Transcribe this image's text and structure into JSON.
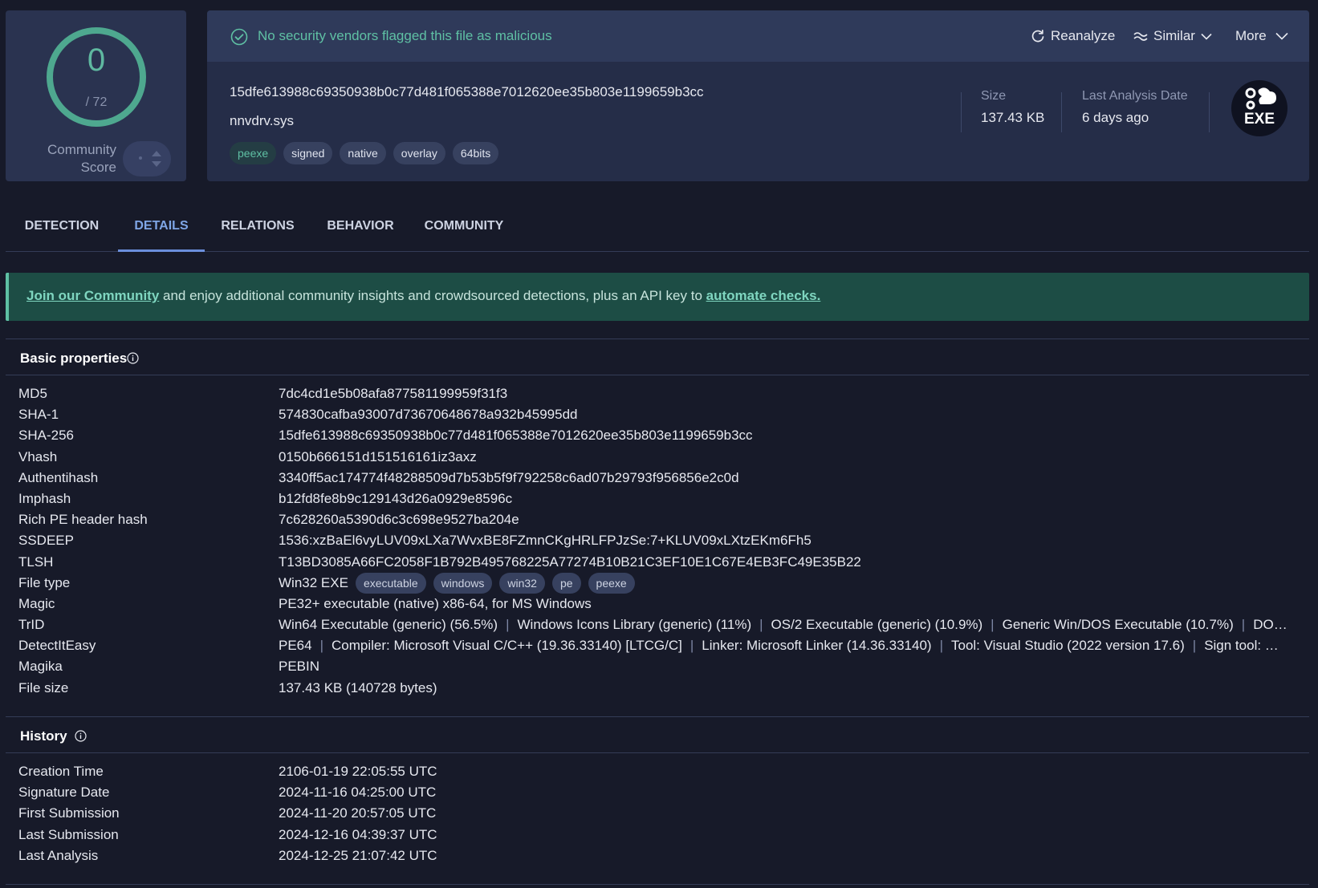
{
  "score": {
    "positives": "0",
    "total": "/ 72",
    "community_label": "Community Score",
    "ring_color": "#4ea88f"
  },
  "verdict": {
    "text": "No security vendors flagged this file as malicious",
    "color": "#5fc0a4",
    "icon": "check-circle-icon"
  },
  "actions": {
    "reanalyze": "Reanalyze",
    "similar": "Similar",
    "more": "More"
  },
  "file": {
    "sha256": "15dfe613988c69350938b0c77d481f065388e7012620ee35b803e1199659b3cc",
    "name": "nnvdrv.sys",
    "tags": [
      "peexe",
      "signed",
      "native",
      "overlay",
      "64bits"
    ],
    "size_label": "Size",
    "size_value": "137.43 KB",
    "last_analysis_label": "Last Analysis Date",
    "last_analysis_value": "6 days ago",
    "type_badge": "EXE"
  },
  "tabs": [
    "DETECTION",
    "DETAILS",
    "RELATIONS",
    "BEHAVIOR",
    "COMMUNITY"
  ],
  "active_tab": "DETAILS",
  "banner": {
    "link1": "Join our Community",
    "middle": " and enjoy additional community insights and crowdsourced detections, plus an API key to ",
    "link2": "automate checks."
  },
  "basic": {
    "title": "Basic properties",
    "rows": [
      {
        "k": "MD5",
        "v": "7dc4cd1e5b08afa877581199959f31f3"
      },
      {
        "k": "SHA-1",
        "v": "574830cafba93007d73670648678a932b45995dd"
      },
      {
        "k": "SHA-256",
        "v": "15dfe613988c69350938b0c77d481f065388e7012620ee35b803e1199659b3cc"
      },
      {
        "k": "Vhash",
        "v": "0150b666151d151516161iz3axz"
      },
      {
        "k": "Authentihash",
        "v": "3340ff5ac174774f48288509d7b53b5f9f792258c6ad07b29793f956856e2c0d"
      },
      {
        "k": "Imphash",
        "v": "b12fd8fe8b9c129143d26a0929e8596c"
      },
      {
        "k": "Rich PE header hash",
        "v": "7c628260a5390d6c3c698e9527ba204e"
      },
      {
        "k": "SSDEEP",
        "v": "1536:xzBaEl6vyLUV09xLXa7WvxBE8FZmnCKgHRLFPJzSe:7+KLUV09xLXtzEKm6Fh5"
      },
      {
        "k": "TLSH",
        "v": "T13BD3085A66FC2058F1B792B495768225A77274B10B21C3EF10E1C67E4EB3FC49E35B22"
      }
    ],
    "file_type": {
      "k": "File type",
      "v": "Win32 EXE",
      "tags": [
        "executable",
        "windows",
        "win32",
        "pe",
        "peexe"
      ]
    },
    "magic": {
      "k": "Magic",
      "v": "PE32+ executable (native) x86-64, for MS Windows"
    },
    "trid": {
      "k": "TrID",
      "parts": [
        "Win64 Executable (generic) (56.5%)",
        "Windows Icons Library (generic) (11%)",
        "OS/2 Executable (generic) (10.9%)",
        "Generic Win/DOS Executable (10.7%)",
        "DOS Executa…"
      ]
    },
    "die": {
      "k": "DetectItEasy",
      "parts": [
        "PE64",
        "Compiler: Microsoft Visual C/C++ (19.36.33140) [LTCG/C]",
        "Linker: Microsoft Linker (14.36.33140)",
        "Tool: Visual Studio (2022 version 17.6)",
        "Sign tool: Windows A…"
      ]
    },
    "magika": {
      "k": "Magika",
      "v": "PEBIN"
    },
    "file_size": {
      "k": "File size",
      "v": "137.43 KB (140728 bytes)"
    }
  },
  "history": {
    "title": "History",
    "rows": [
      {
        "k": "Creation Time",
        "v": "2106-01-19 22:05:55 UTC"
      },
      {
        "k": "Signature Date",
        "v": "2024-11-16 04:25:00 UTC"
      },
      {
        "k": "First Submission",
        "v": "2024-11-20 20:57:05 UTC"
      },
      {
        "k": "Last Submission",
        "v": "2024-12-16 04:39:37 UTC"
      },
      {
        "k": "Last Analysis",
        "v": "2024-12-25 21:07:42 UTC"
      }
    ]
  }
}
